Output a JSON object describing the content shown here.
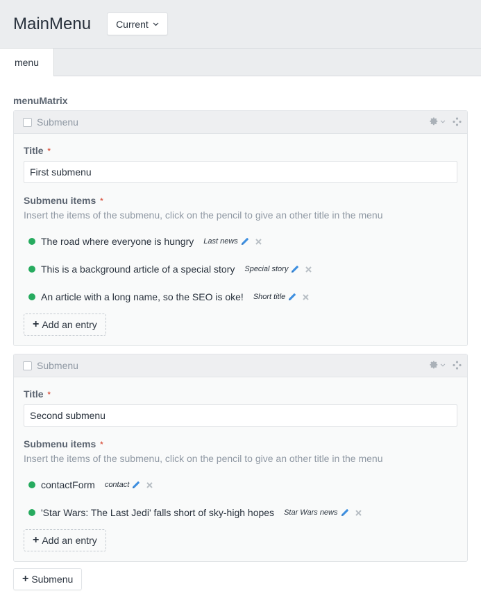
{
  "header": {
    "title": "MainMenu",
    "version_button": "Current"
  },
  "tabs": [
    {
      "label": "menu"
    }
  ],
  "field": {
    "label": "menuMatrix"
  },
  "blocks": [
    {
      "type_label": "Submenu",
      "title_label": "Title",
      "title_required": "*",
      "title_value": "First submenu",
      "items_label": "Submenu items",
      "items_required": "*",
      "instructions": "Insert the items of the submenu, click on the pencil to give an other title in the menu",
      "entries": [
        {
          "title": "The road where everyone is hungry",
          "alias": "Last news"
        },
        {
          "title": "This is a background article of a special story",
          "alias": "Special story"
        },
        {
          "title": "An article with a long name, so the SEO is oke!",
          "alias": "Short title"
        }
      ],
      "add_entry_label": "Add an entry"
    },
    {
      "type_label": "Submenu",
      "title_label": "Title",
      "title_required": "*",
      "title_value": "Second submenu",
      "items_label": "Submenu items",
      "items_required": "*",
      "instructions": "Insert the items of the submenu, click on the pencil to give an other title in the menu",
      "entries": [
        {
          "title": "contactForm",
          "alias": "contact"
        },
        {
          "title": "'Star Wars: The Last Jedi' falls short of sky-high hopes",
          "alias": "Star Wars news"
        }
      ],
      "add_entry_label": "Add an entry"
    }
  ],
  "add_block_label": "Submenu",
  "icons": {
    "plus": "plus-icon",
    "pencil": "pencil-icon",
    "remove": "remove-icon",
    "settings": "gear-icon",
    "move": "move-icon",
    "chevron": "chevron-down-icon"
  },
  "colors": {
    "enabled_dot": "#27ab5f",
    "pencil": "#3e8fe0",
    "required": "#da5a47",
    "header_bg": "#ebedef"
  }
}
